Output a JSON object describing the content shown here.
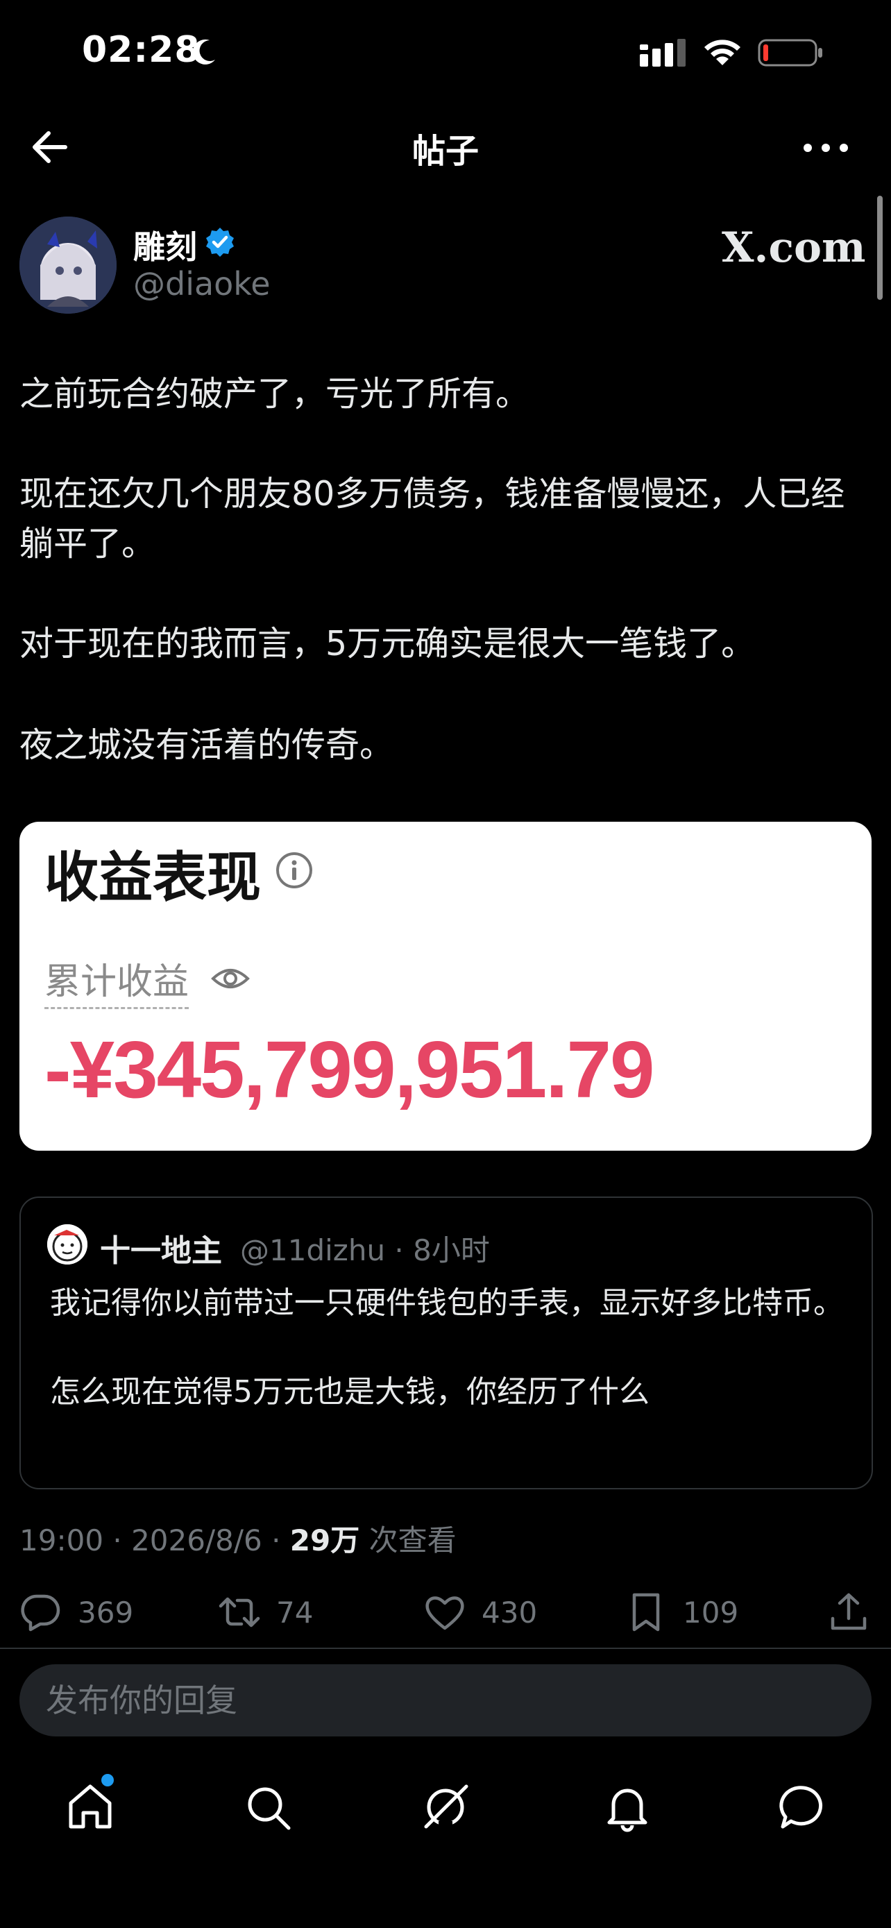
{
  "status_bar": {
    "time": "02:28"
  },
  "nav": {
    "title": "帖子"
  },
  "author": {
    "name": "雕刻",
    "handle": "@diaoke",
    "badge": "X.com"
  },
  "post": {
    "paragraphs": [
      "之前玩合约破产了，亏光了所有。",
      "现在还欠几个朋友80多万债务，钱准备慢慢还，人已经躺平了。",
      "对于现在的我而言，5万元确实是很大一笔钱了。",
      "夜之城没有活着的传奇。"
    ]
  },
  "earnings_card": {
    "title": "收益表现",
    "label": "累计收益",
    "value": "-¥345,799,951.79",
    "value_color": "#e64665"
  },
  "quote": {
    "name": "十一地主",
    "meta": "@11dizhu · 8小时",
    "line1": "我记得你以前带过一只硬件钱包的手表，显示好多比特币。",
    "line2": "怎么现在觉得5万元也是大钱，你经历了什么"
  },
  "timestamp": {
    "time": "19:00 · 2026/8/6 · ",
    "views_count": "29万",
    "views_label": " 次查看"
  },
  "actions": {
    "replies": "369",
    "reposts": "74",
    "likes": "430",
    "bookmarks": "109"
  },
  "reply": {
    "placeholder": "发布你的回复"
  },
  "tabs": [
    "home-icon",
    "search-icon",
    "grok-icon",
    "bell-icon",
    "messages-icon"
  ],
  "colors": {
    "accent": "#1d9bf0",
    "muted": "#71767b",
    "background": "#000000"
  }
}
